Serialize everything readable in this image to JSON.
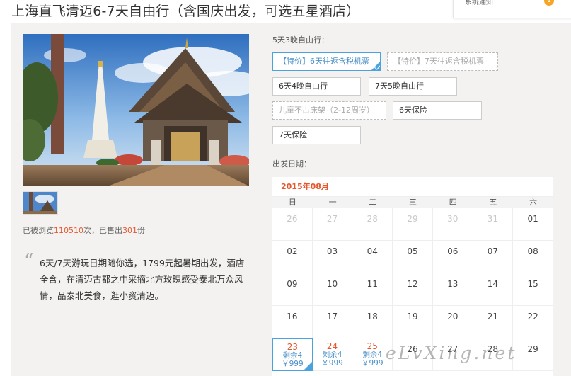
{
  "page_title": "上海直飞清迈6-7天自由行（含国庆出发，可选五星酒店）",
  "notice": {
    "label": "系统通知",
    "count": "1"
  },
  "stats": {
    "prefix": "已被浏览",
    "views": "110510",
    "mid": "次，已售出",
    "sold": "301",
    "suffix": "份"
  },
  "description": "6天/7天游玩日期随你选，1799元起暑期出发，酒店全含，在清迈古都之中采摘北方玫瑰感受泰北万众风情，品泰北美食，逛小资清迈。",
  "package_label": "5天3晚自由行：",
  "options": [
    {
      "label": "【特价】6天往返含税机票",
      "state": "selected"
    },
    {
      "label": "【特价】7天往返含税机票",
      "state": "disabled"
    },
    {
      "label": "6天4晚自由行",
      "state": "normal"
    },
    {
      "label": "7天5晚自由行",
      "state": "normal"
    },
    {
      "label": "儿童不占床架（2-12周岁）",
      "state": "disabled"
    },
    {
      "label": "6天保险",
      "state": "normal"
    },
    {
      "label": "7天保险",
      "state": "normal"
    }
  ],
  "date_label": "出发日期：",
  "calendar": {
    "month": "2015年08月",
    "weekdays": [
      "日",
      "一",
      "二",
      "三",
      "四",
      "五",
      "六"
    ],
    "cells": [
      {
        "d": "26",
        "muted": true
      },
      {
        "d": "27",
        "muted": true
      },
      {
        "d": "28",
        "muted": true
      },
      {
        "d": "29",
        "muted": true
      },
      {
        "d": "30",
        "muted": true
      },
      {
        "d": "31",
        "muted": true
      },
      {
        "d": "01"
      },
      {
        "d": "02"
      },
      {
        "d": "03"
      },
      {
        "d": "04"
      },
      {
        "d": "05"
      },
      {
        "d": "06"
      },
      {
        "d": "07"
      },
      {
        "d": "08"
      },
      {
        "d": "09"
      },
      {
        "d": "10"
      },
      {
        "d": "11"
      },
      {
        "d": "12"
      },
      {
        "d": "13"
      },
      {
        "d": "14"
      },
      {
        "d": "15"
      },
      {
        "d": "16"
      },
      {
        "d": "17"
      },
      {
        "d": "18"
      },
      {
        "d": "19"
      },
      {
        "d": "20"
      },
      {
        "d": "21"
      },
      {
        "d": "22"
      },
      {
        "d": "23",
        "stock": "剩余4",
        "price": "￥999",
        "selected": true
      },
      {
        "d": "24",
        "stock": "剩余4",
        "price": "￥999"
      },
      {
        "d": "25",
        "stock": "剩余4",
        "price": "￥999"
      },
      {
        "d": "26"
      },
      {
        "d": "27"
      },
      {
        "d": "28"
      },
      {
        "d": "29"
      }
    ]
  },
  "watermark": "eLvXing.net",
  "colors": {
    "accent": "#4aa3df",
    "highlight": "#e4572e",
    "panel_bg": "#f3f2f0"
  }
}
